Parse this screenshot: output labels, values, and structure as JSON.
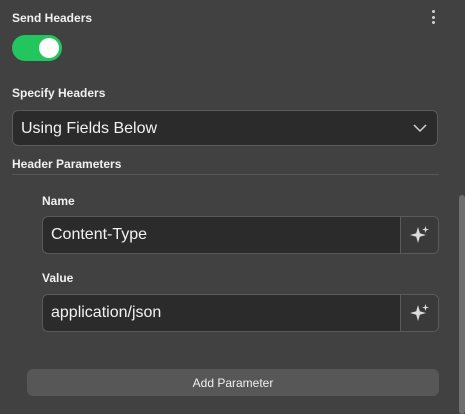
{
  "send_headers": {
    "label": "Send Headers",
    "enabled": true,
    "options_icon": "more-vertical-icon"
  },
  "specify_headers": {
    "label": "Specify Headers",
    "selected": "Using Fields Below",
    "dropdown_icon": "chevron-down-icon"
  },
  "header_parameters": {
    "label": "Header Parameters",
    "items": [
      {
        "name_label": "Name",
        "name_value": "Content-Type",
        "value_label": "Value",
        "value_value": "application/json",
        "expression_icon": "sparkle-icon"
      }
    ]
  },
  "add_parameter_label": "Add Parameter",
  "colors": {
    "toggle_on": "#22c55e",
    "background": "#414141",
    "input_bg": "#2b2b2b"
  }
}
